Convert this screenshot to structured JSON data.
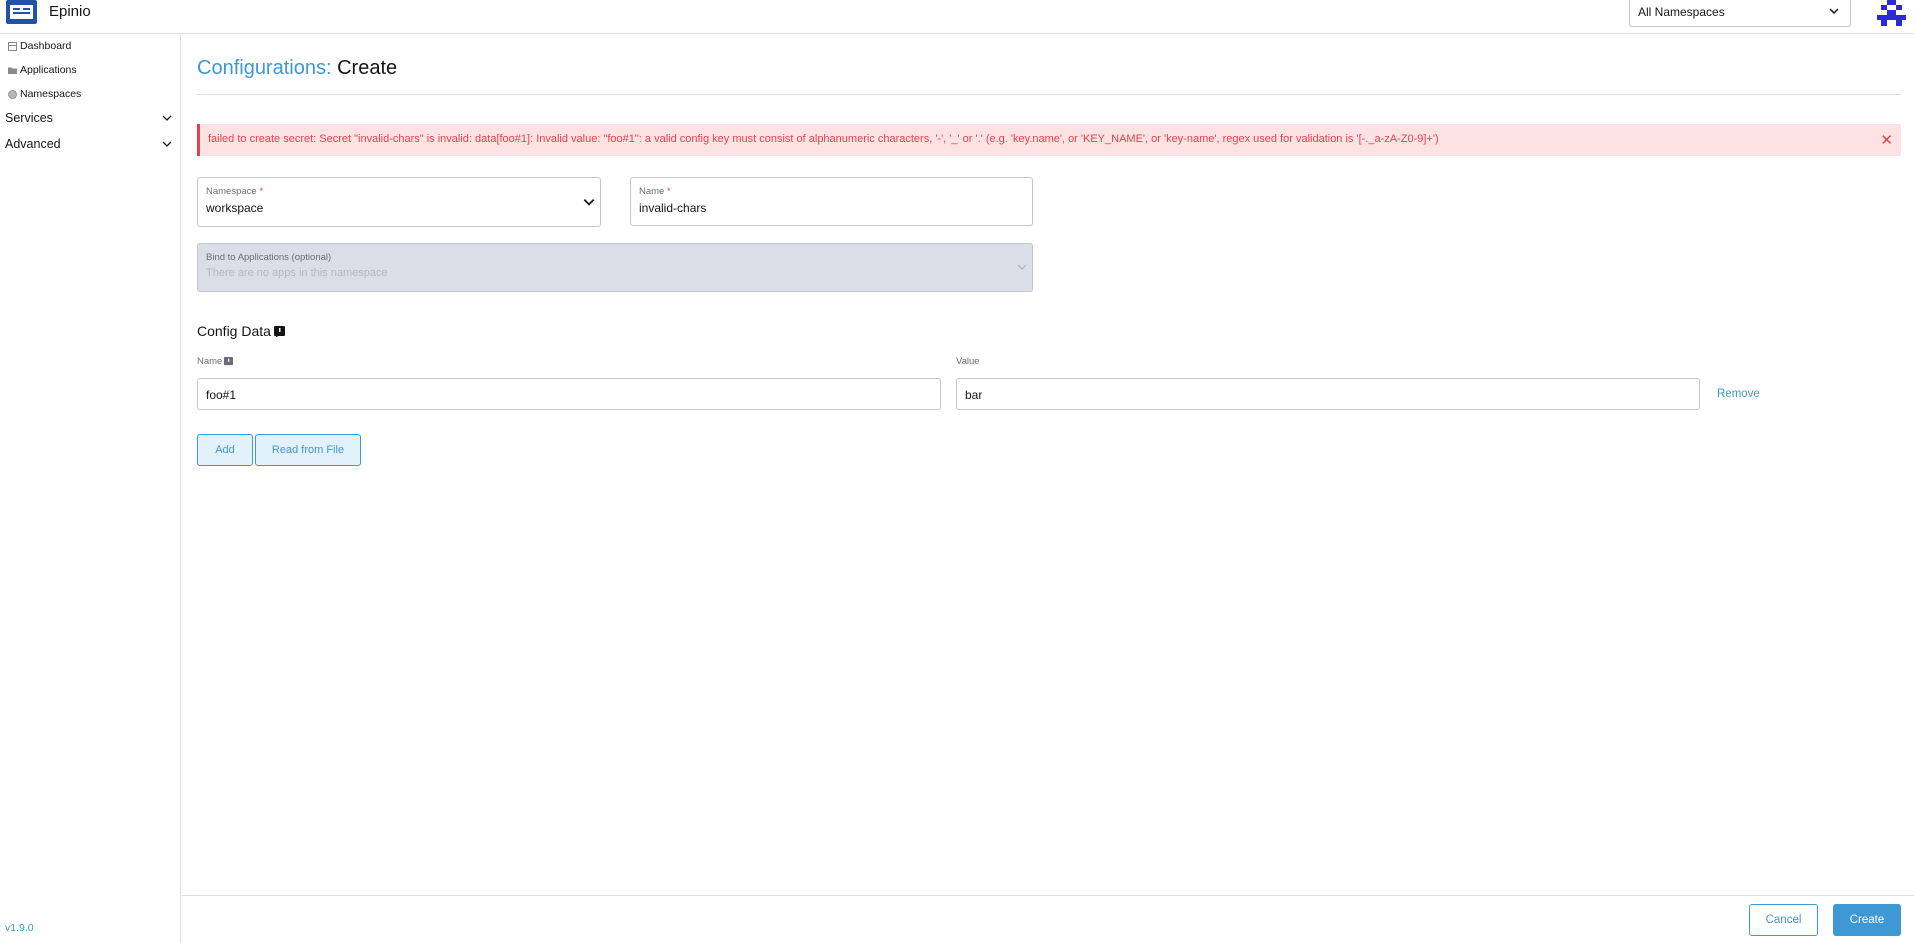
{
  "header": {
    "app_title": "Epinio",
    "namespace_selector": "All Namespaces"
  },
  "sidebar": {
    "items": [
      {
        "label": "Dashboard",
        "icon": "dashboard-icon"
      },
      {
        "label": "Applications",
        "icon": "folder-icon"
      },
      {
        "label": "Namespaces",
        "icon": "globe-icon"
      }
    ],
    "groups": [
      {
        "label": "Services"
      },
      {
        "label": "Advanced"
      }
    ],
    "version": "v1.9.0"
  },
  "page": {
    "crumb": "Configurations:",
    "title": "Create"
  },
  "error": {
    "message": "failed to create secret: Secret \"invalid-chars\" is invalid: data[foo#1]: Invalid value: \"foo#1\": a valid config key must consist of alphanumeric characters, '-', '_' or '.' (e.g. 'key.name', or 'KEY_NAME', or 'key-name', regex used for validation is '[-._a-zA-Z0-9]+')"
  },
  "form": {
    "namespace": {
      "label": "Namespace",
      "required_mark": "*",
      "value": "workspace"
    },
    "name": {
      "label": "Name",
      "required_mark": "*",
      "value": "invalid-chars"
    },
    "bind": {
      "label": "Bind to Applications (optional)",
      "placeholder": "There are no apps in this namespace"
    }
  },
  "config_data": {
    "title": "Config Data",
    "name_label": "Name",
    "value_label": "Value",
    "rows": [
      {
        "key": "foo#1",
        "value": "bar",
        "remove_label": "Remove"
      }
    ],
    "add_label": "Add",
    "read_file_label": "Read from File"
  },
  "footer": {
    "cancel_label": "Cancel",
    "create_label": "Create"
  },
  "colors": {
    "accent": "#3d98d3",
    "error": "#e1444c",
    "error_bg": "#fde2e3"
  }
}
